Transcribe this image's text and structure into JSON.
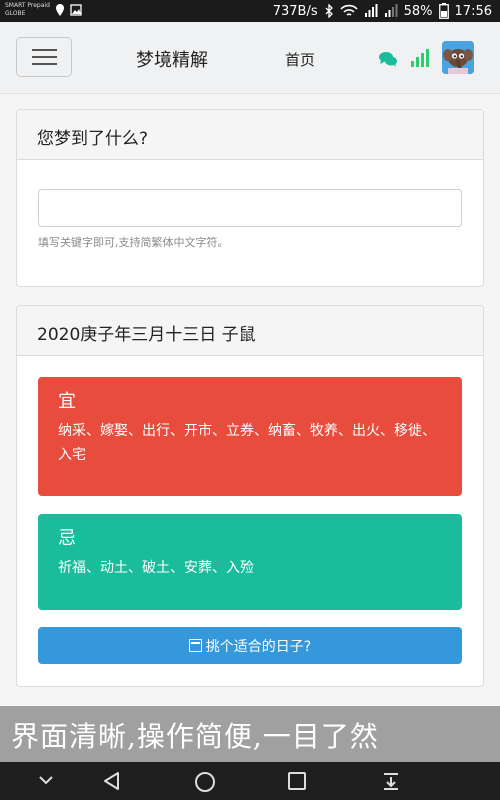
{
  "status_bar": {
    "carrier_line1": "SMART Prepaid",
    "carrier_line2": "GLOBE",
    "speed": "737B/s",
    "battery": "58%",
    "time": "17:56"
  },
  "navbar": {
    "title": "梦境精解",
    "home_link": "首页"
  },
  "search_panel": {
    "heading": "您梦到了什么?",
    "input_value": "",
    "input_placeholder": "",
    "help_text": "填写关键字即可,支持简繁体中文字符。"
  },
  "almanac_panel": {
    "heading": "2020庚子年三月十三日 子鼠",
    "yi": {
      "title": "宜",
      "text": "纳采、嫁娶、出行、开市、立券、纳畜、牧养、出火、移徙、入宅"
    },
    "ji": {
      "title": "忌",
      "text": "祈福、动土、破土、安葬、入殓"
    },
    "pick_button": "挑个适合的日子?"
  },
  "banner": {
    "text": "界面清晰,操作简便,一目了然"
  },
  "colors": {
    "yi_red": "#e74c3c",
    "ji_green": "#1abc9c",
    "button_blue": "#3498db",
    "icon_teal": "#1abc9c",
    "signal_green": "#2ecc71"
  },
  "icons": [
    "image-icon",
    "location-icon",
    "bluetooth-icon",
    "wifi-icon",
    "cell-signal-icon",
    "battery-icon",
    "chat-icon",
    "signal-bars-icon",
    "avatar",
    "calendar-icon",
    "back-icon",
    "home-icon",
    "recents-icon",
    "notification-pull-icon"
  ]
}
